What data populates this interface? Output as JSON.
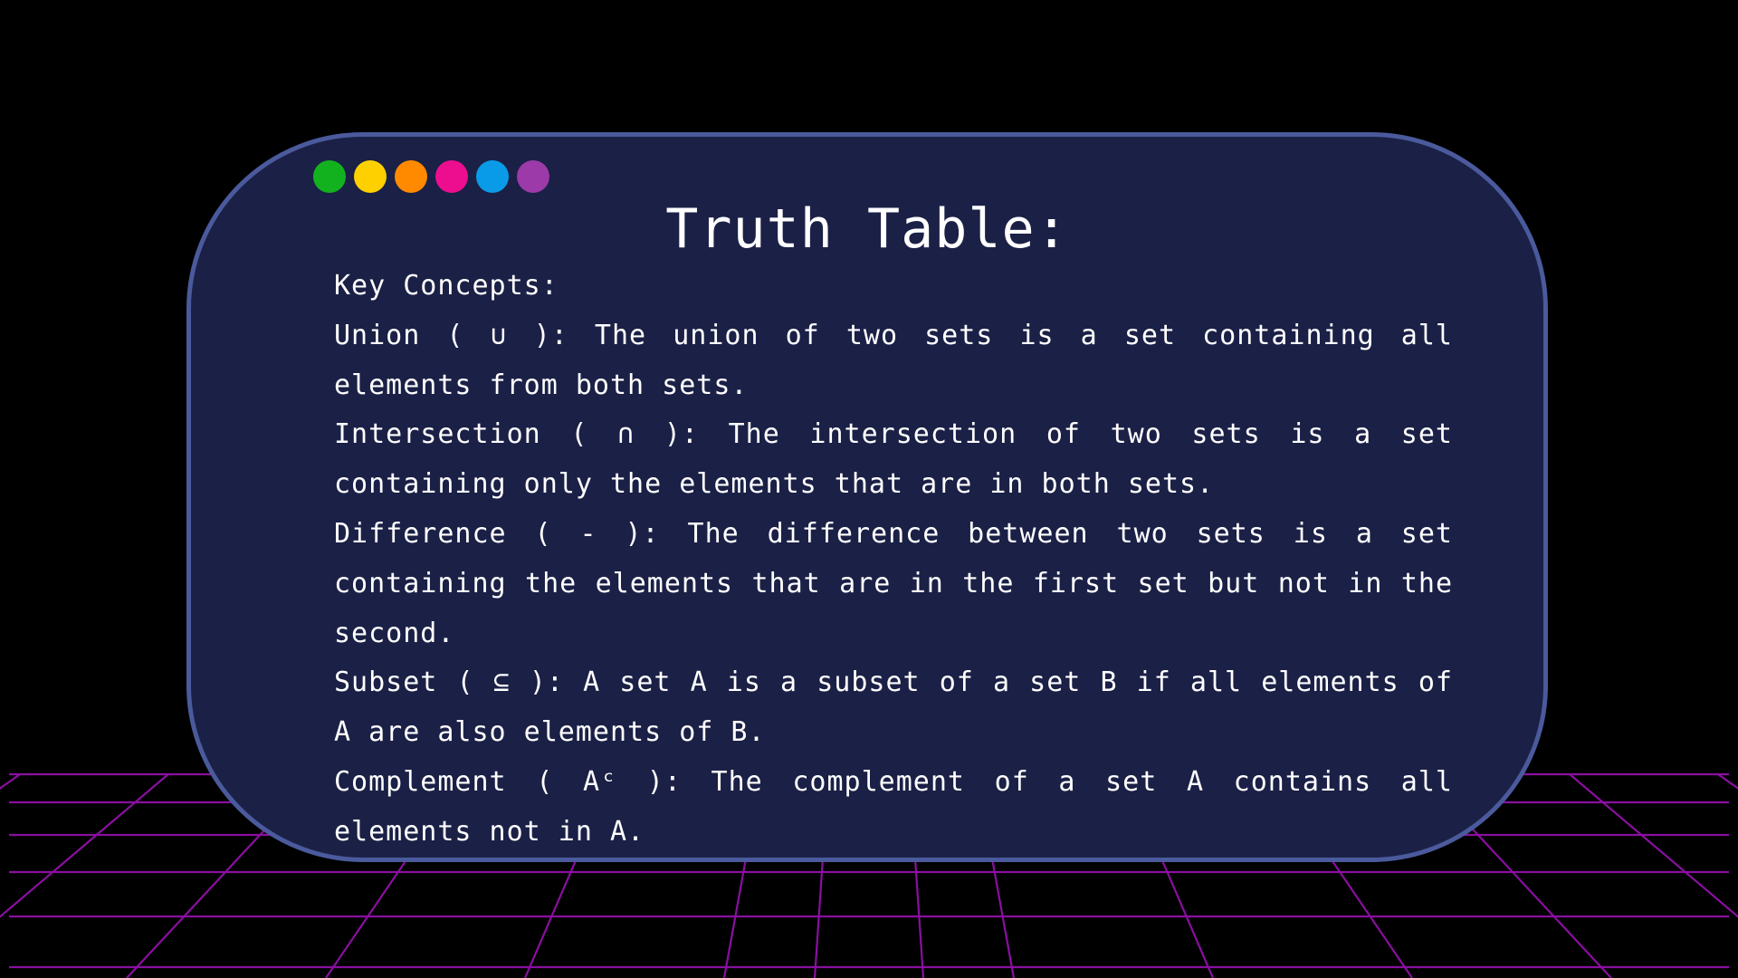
{
  "colors": {
    "background": "#000000",
    "card_fill": "#1b2046",
    "card_border": "#4a5a9c",
    "grid_line": "#8a0fa0",
    "text": "#ffffff"
  },
  "dots": [
    {
      "name": "green-dot",
      "color": "#12b21e"
    },
    {
      "name": "yellow-dot",
      "color": "#ffd000"
    },
    {
      "name": "orange-dot",
      "color": "#ff8a00"
    },
    {
      "name": "pink-dot",
      "color": "#ec0e8f"
    },
    {
      "name": "blue-dot",
      "color": "#0a9be8"
    },
    {
      "name": "purple-dot",
      "color": "#9b3aa8"
    }
  ],
  "title": "Truth Table:",
  "heading": "Key Concepts:",
  "concepts": [
    "Union ( ∪ ): The union of two sets is a set containing all elements from both sets.",
    "Intersection ( ∩ ): The intersection of two sets is a set containing only the elements that are in both sets.",
    "Difference ( - ): The difference between two sets is a set containing the elements that are in the first set but not in the second.",
    "Subset ( ⊆ ): A set A is a subset of a set B if all elements of A are also elements of B.",
    "Complement ( Aᶜ ): The complement of a set A contains all elements not in A."
  ]
}
